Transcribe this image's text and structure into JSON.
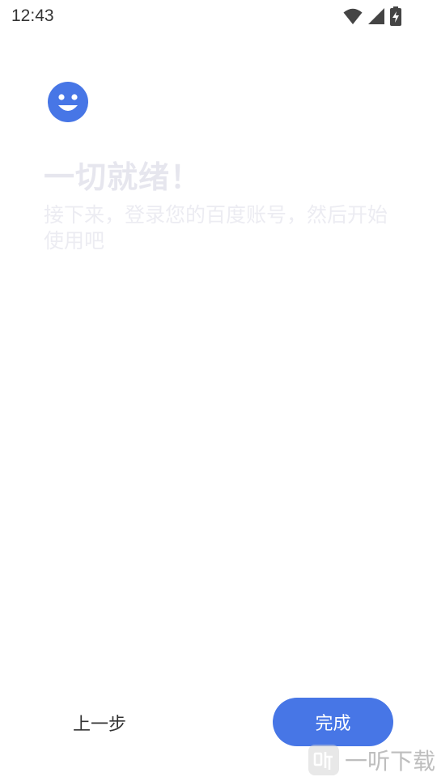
{
  "status_bar": {
    "time": "12:43",
    "icons": [
      "wifi-icon",
      "signal-icon",
      "battery-charging-icon"
    ]
  },
  "main": {
    "icon": "smiley-face-icon",
    "title": "一切就绪！",
    "subtitle": "接下来，登录您的百度账号，然后开始使用吧"
  },
  "footer": {
    "prev_label": "上一步",
    "finish_label": "完成"
  },
  "watermark": {
    "icon": "ting-logo-icon",
    "text": "一听下载"
  },
  "colors": {
    "accent": "#4776e6",
    "title_text": "#e6e6ee",
    "body_text": "#333333"
  }
}
